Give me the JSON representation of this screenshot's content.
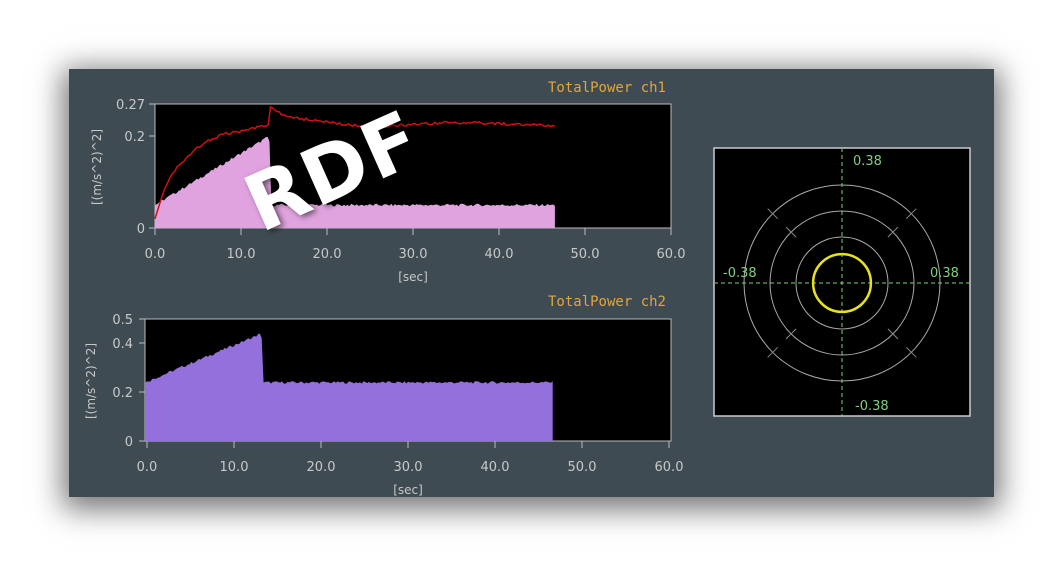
{
  "badge": "RDF",
  "charts": {
    "ch1": {
      "title": "TotalPower ch1",
      "yticks": [
        "0.27",
        "0.2",
        "0"
      ],
      "xticks": [
        "0.0",
        "10.0",
        "20.0",
        "30.0",
        "40.0",
        "50.0",
        "60.0"
      ],
      "xlabel": "[sec]",
      "ylabel": "[(m/s^2)^2]"
    },
    "ch2": {
      "title": "TotalPower ch2",
      "yticks": [
        "0.5",
        "0.4",
        "0.2",
        "0"
      ],
      "xticks": [
        "0.0",
        "10.0",
        "20.0",
        "30.0",
        "40.0",
        "50.0",
        "60.0"
      ],
      "xlabel": "[sec]",
      "ylabel": "[(m/s^2)^2]"
    }
  },
  "polar": {
    "top": "0.38",
    "bottom": "-0.38",
    "left": "-0.38",
    "right": "0.38",
    "trace_radius": 0.1
  },
  "colors": {
    "panel": "#3f4b52",
    "ch1_fill": "#e0a3df",
    "ch1_line": "#d01010",
    "ch2_fill": "#9370db",
    "polar_trace": "#e8e21a",
    "polar_axes": "#7fd07f"
  },
  "chart_data": [
    {
      "type": "area",
      "title": "TotalPower ch1",
      "xlabel": "[sec]",
      "ylabel": "[(m/s^2)^2]",
      "xlim": [
        0,
        60
      ],
      "ylim": [
        0,
        0.27
      ],
      "series": [
        {
          "x": [
            0,
            1,
            2,
            4,
            6,
            8,
            10,
            12,
            13.2,
            13.3,
            15,
            18,
            22,
            26,
            30,
            34,
            38,
            42,
            46.5
          ],
          "values": [
            0.02,
            0.08,
            0.12,
            0.16,
            0.19,
            0.205,
            0.21,
            0.22,
            0.225,
            0.265,
            0.245,
            0.235,
            0.225,
            0.22,
            0.225,
            0.23,
            0.228,
            0.226,
            0.222
          ]
        },
        {
          "x": [
            0,
            13.3,
            13.5,
            46.5
          ],
          "values": [
            0.05,
            0.2,
            0.05,
            0.05
          ]
        }
      ]
    },
    {
      "type": "area",
      "title": "TotalPower ch2",
      "xlabel": "[sec]",
      "ylabel": "[(m/s^2)^2]",
      "xlim": [
        0,
        60
      ],
      "ylim": [
        0,
        0.5
      ],
      "series": [
        {
          "x": [
            0,
            13.3,
            13.5,
            46.5
          ],
          "values": [
            0.24,
            0.44,
            0.24,
            0.24
          ]
        }
      ]
    }
  ]
}
